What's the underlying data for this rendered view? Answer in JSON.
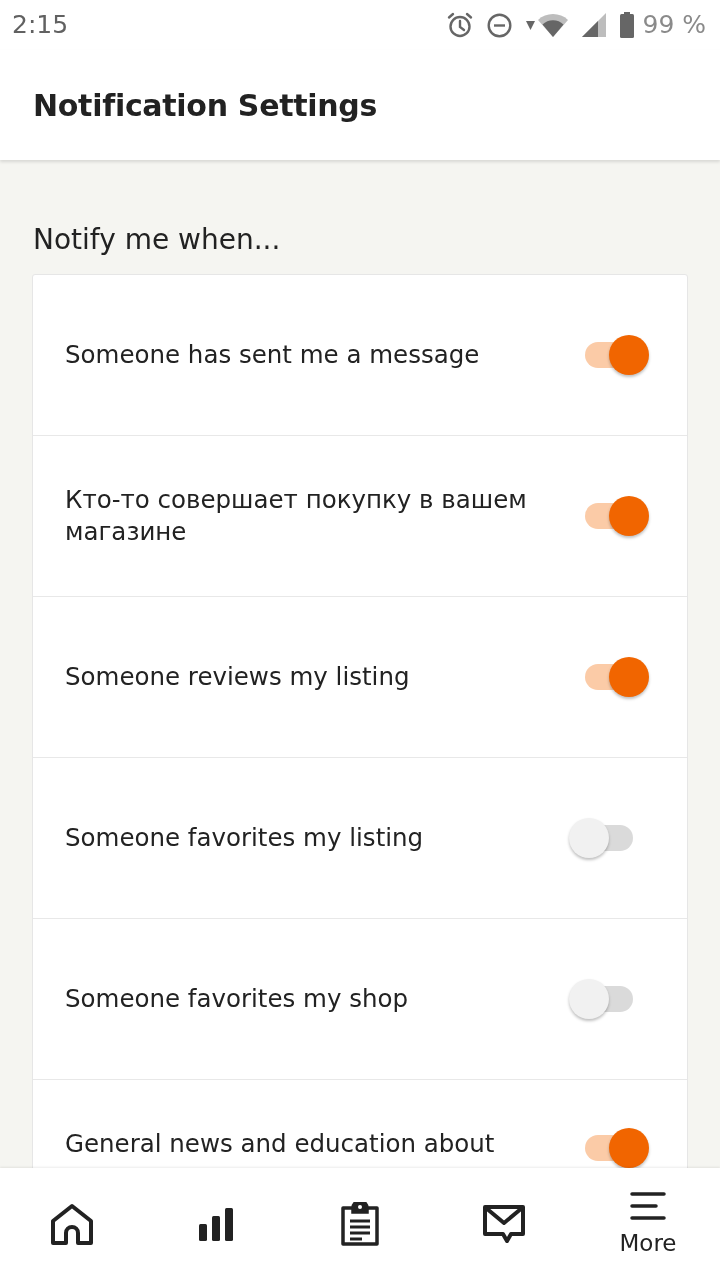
{
  "status_bar": {
    "time": "2:15",
    "battery": "99 %"
  },
  "header": {
    "title": "Notification Settings"
  },
  "section": {
    "heading": "Notify me when..."
  },
  "settings": [
    {
      "label": "Someone has sent me a message",
      "on": true
    },
    {
      "label": "Кто-то совершает покупку в вашем магазине",
      "on": true
    },
    {
      "label": "Someone reviews my listing",
      "on": true
    },
    {
      "label": "Someone favorites my listing",
      "on": false
    },
    {
      "label": "Someone favorites my shop",
      "on": false
    },
    {
      "label": "General news and education about",
      "on": true
    }
  ],
  "bottom_nav": {
    "items": [
      {
        "kind": "home"
      },
      {
        "kind": "stats"
      },
      {
        "kind": "orders"
      },
      {
        "kind": "messages"
      },
      {
        "kind": "more",
        "label": "More"
      }
    ]
  }
}
